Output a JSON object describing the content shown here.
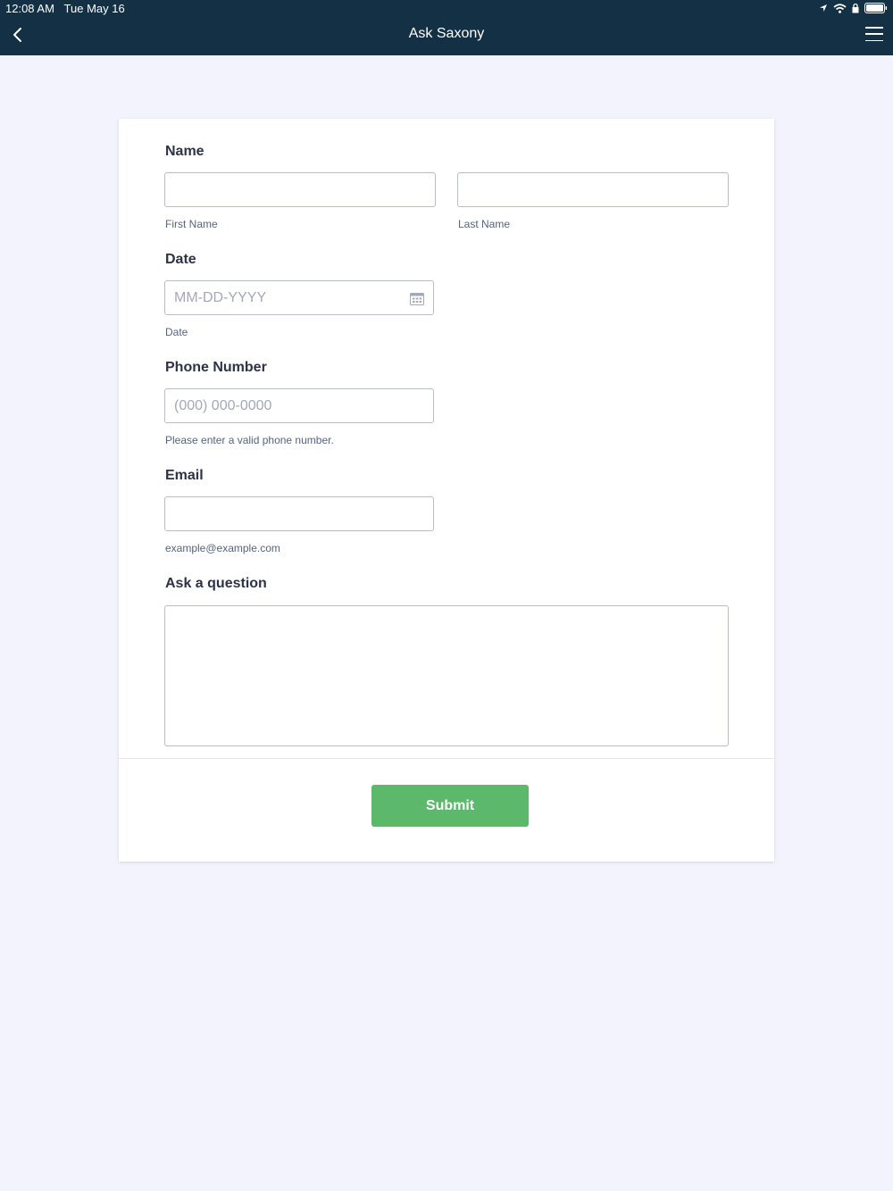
{
  "status_bar": {
    "time": "12:08 AM",
    "date": "Tue May 16",
    "icons": [
      "location-icon",
      "wifi-icon",
      "lock-rotation-icon",
      "battery-icon"
    ]
  },
  "nav": {
    "title": "Ask Saxony",
    "back_icon": "chevron-left-icon",
    "menu_icon": "hamburger-menu-icon"
  },
  "form": {
    "name": {
      "label": "Name",
      "first_value": "",
      "first_sublabel": "First Name",
      "last_value": "",
      "last_sublabel": "Last Name"
    },
    "date": {
      "label": "Date",
      "placeholder": "MM-DD-YYYY",
      "sublabel": "Date",
      "icon": "calendar-icon"
    },
    "phone": {
      "label": "Phone Number",
      "placeholder": "(000) 000-0000",
      "sublabel": "Please enter a valid phone number."
    },
    "email": {
      "label": "Email",
      "value": "",
      "sublabel": "example@example.com"
    },
    "question": {
      "label": "Ask a question",
      "value": ""
    },
    "submit_label": "Submit"
  },
  "colors": {
    "header_bg": "#133045",
    "page_bg": "#f2f3fc",
    "submit_bg": "#5cb96b"
  }
}
